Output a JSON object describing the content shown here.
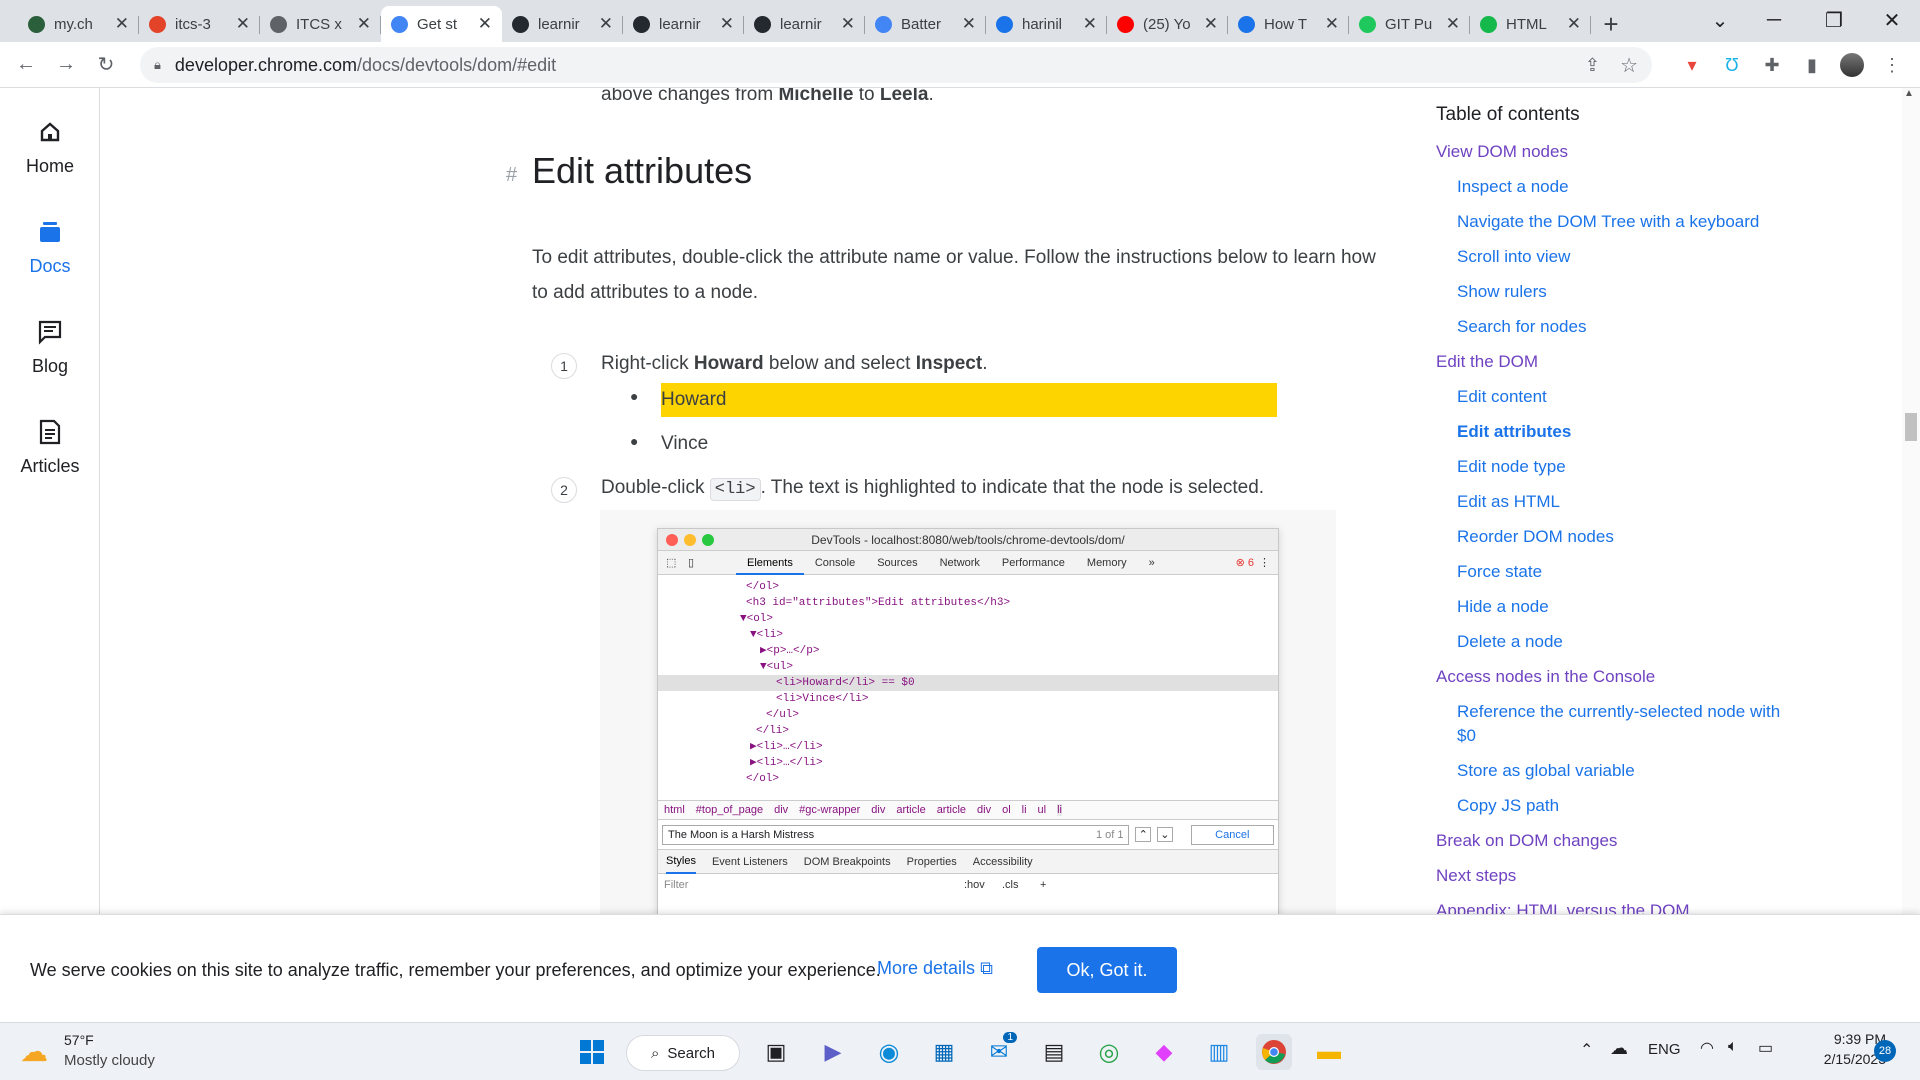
{
  "browser": {
    "tabs": [
      {
        "title": "my.ch",
        "icon": "g-icon",
        "color": "#2b5f3b"
      },
      {
        "title": "itcs-3",
        "icon": "gitlab-icon",
        "color": "#e24329"
      },
      {
        "title": "ITCS x",
        "icon": "globe-icon",
        "color": "#5f6368"
      },
      {
        "title": "Get st",
        "icon": "chrome-icon",
        "color": "#4285f4"
      },
      {
        "title": "learnir",
        "icon": "github-icon",
        "color": "#24292f"
      },
      {
        "title": "learnir",
        "icon": "github-icon",
        "color": "#24292f"
      },
      {
        "title": "learnir",
        "icon": "github-icon",
        "color": "#24292f"
      },
      {
        "title": "Batter",
        "icon": "docs-icon",
        "color": "#4285f4"
      },
      {
        "title": "harinil",
        "icon": "stats-icon",
        "color": "#1a73e8"
      },
      {
        "title": "(25) Yo",
        "icon": "youtube-icon",
        "color": "#ff0000"
      },
      {
        "title": "How T",
        "icon": "tw-icon",
        "color": "#1a73e8"
      },
      {
        "title": "GIT Pu",
        "icon": "bc-icon",
        "color": "#1ec85c"
      },
      {
        "title": "HTML",
        "icon": "w-icon",
        "color": "#14b84b"
      }
    ],
    "url_domain": "developer.chrome.com",
    "url_path": "/docs/devtools/dom/#edit"
  },
  "rail": {
    "items": [
      {
        "label": "Home"
      },
      {
        "label": "Docs"
      },
      {
        "label": "Blog"
      },
      {
        "label": "Articles"
      }
    ]
  },
  "article": {
    "prev_line_prefix": "above changes from ",
    "prev_name1": "Michelle",
    "prev_mid": " to ",
    "prev_name2": "Leela",
    "prev_end": ".",
    "hash": "#",
    "heading": "Edit attributes",
    "intro": "To edit attributes, double-click the attribute name or value. Follow the instructions below to learn how to add attributes to a node.",
    "step1_num": "1",
    "step1_a": "Right-click ",
    "step1_b": "Howard",
    "step1_c": " below and select ",
    "step1_d": "Inspect",
    "step1_e": ".",
    "list_items": [
      "Howard",
      "Vince"
    ],
    "step2_num": "2",
    "step2_a": "Double-click ",
    "step2_code": "<li>",
    "step2_b": ". The text is highlighted to indicate that the node is selected."
  },
  "devtools": {
    "title": "DevTools - localhost:8080/web/tools/chrome-devtools/dom/",
    "tabs": [
      "Elements",
      "Console",
      "Sources",
      "Network",
      "Performance",
      "Memory",
      "»"
    ],
    "errors": "6",
    "tree": [
      "</ol>",
      "<h3 id=\"attributes\">Edit attributes</h3>",
      "▼<ol>",
      "▼<li>",
      "▶<p>…</p>",
      "▼<ul>",
      "<li>Howard</li> == $0",
      "<li>Vince</li>",
      "</ul>",
      "</li>",
      "▶<li>…</li>",
      "▶<li>…</li>",
      "</ol>"
    ],
    "breadcrumbs": [
      "html",
      "#top_of_page",
      "div",
      "#gc-wrapper",
      "div",
      "article",
      "article",
      "div",
      "ol",
      "li",
      "ul",
      "li"
    ],
    "search_value": "The Moon is a Harsh Mistress",
    "search_count": "1 of 1",
    "cancel": "Cancel",
    "lower_tabs": [
      "Styles",
      "Event Listeners",
      "DOM Breakpoints",
      "Properties",
      "Accessibility"
    ],
    "filter": "Filter",
    "hov": ":hov",
    "cls": ".cls",
    "plus": "+"
  },
  "toc": {
    "title": "Table of contents",
    "items": [
      {
        "label": "View DOM nodes",
        "level": 1
      },
      {
        "label": "Inspect a node",
        "level": 2
      },
      {
        "label": "Navigate the DOM Tree with a keyboard",
        "level": 2
      },
      {
        "label": "Scroll into view",
        "level": 2
      },
      {
        "label": "Show rulers",
        "level": 2
      },
      {
        "label": "Search for nodes",
        "level": 2
      },
      {
        "label": "Edit the DOM",
        "level": 1
      },
      {
        "label": "Edit content",
        "level": 2
      },
      {
        "label": "Edit attributes",
        "level": 2,
        "current": true
      },
      {
        "label": "Edit node type",
        "level": 2
      },
      {
        "label": "Edit as HTML",
        "level": 2
      },
      {
        "label": "Reorder DOM nodes",
        "level": 2
      },
      {
        "label": "Force state",
        "level": 2
      },
      {
        "label": "Hide a node",
        "level": 2
      },
      {
        "label": "Delete a node",
        "level": 2
      },
      {
        "label": "Access nodes in the Console",
        "level": 1
      },
      {
        "label": "Reference the currently-selected node with $0",
        "level": 2
      },
      {
        "label": "Store as global variable",
        "level": 2
      },
      {
        "label": "Copy JS path",
        "level": 2
      },
      {
        "label": "Break on DOM changes",
        "level": 1
      },
      {
        "label": "Next steps",
        "level": 1
      },
      {
        "label": "Appendix: HTML versus the DOM",
        "level": 1
      }
    ]
  },
  "cookie": {
    "text": "We serve cookies on this site to analyze traffic, remember your preferences, and optimize your experience.",
    "more": "More details",
    "ok": "Ok, Got it."
  },
  "taskbar": {
    "temp": "57°F",
    "weather": "Mostly cloudy",
    "search": "Search",
    "lang": "ENG",
    "time": "9:39 PM",
    "date": "2/15/2023",
    "badge": "28",
    "mail_badge": "1"
  }
}
